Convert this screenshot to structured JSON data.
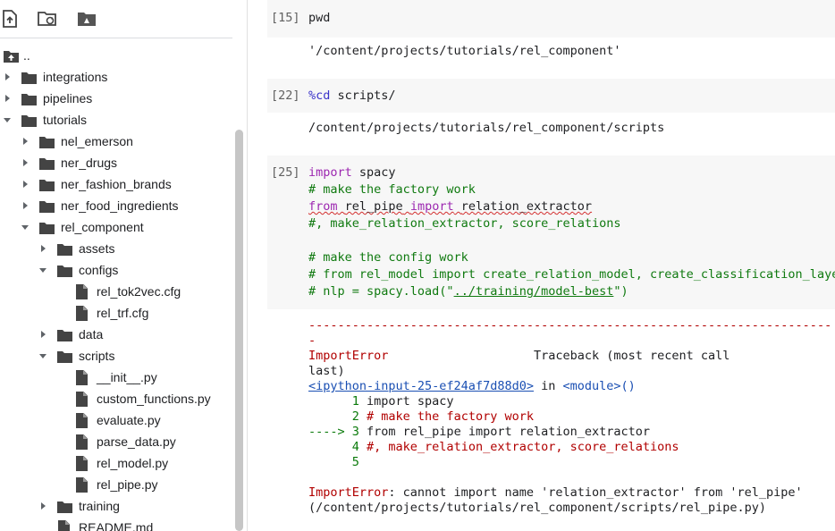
{
  "toolbar": {
    "icons": [
      "upload-file-icon",
      "refresh-folder-icon",
      "google-drive-icon"
    ]
  },
  "tree": [
    {
      "label": "..",
      "type": "up",
      "depth": 0,
      "arrow": "none"
    },
    {
      "label": "integrations",
      "type": "folder",
      "depth": 0,
      "arrow": "right"
    },
    {
      "label": "pipelines",
      "type": "folder",
      "depth": 0,
      "arrow": "right"
    },
    {
      "label": "tutorials",
      "type": "folder",
      "depth": 0,
      "arrow": "down"
    },
    {
      "label": "nel_emerson",
      "type": "folder",
      "depth": 1,
      "arrow": "right"
    },
    {
      "label": "ner_drugs",
      "type": "folder",
      "depth": 1,
      "arrow": "right"
    },
    {
      "label": "ner_fashion_brands",
      "type": "folder",
      "depth": 1,
      "arrow": "right"
    },
    {
      "label": "ner_food_ingredients",
      "type": "folder",
      "depth": 1,
      "arrow": "right"
    },
    {
      "label": "rel_component",
      "type": "folder",
      "depth": 1,
      "arrow": "down"
    },
    {
      "label": "assets",
      "type": "folder",
      "depth": 2,
      "arrow": "right"
    },
    {
      "label": "configs",
      "type": "folder",
      "depth": 2,
      "arrow": "down"
    },
    {
      "label": "rel_tok2vec.cfg",
      "type": "file",
      "depth": 3,
      "arrow": "none"
    },
    {
      "label": "rel_trf.cfg",
      "type": "file",
      "depth": 3,
      "arrow": "none"
    },
    {
      "label": "data",
      "type": "folder",
      "depth": 2,
      "arrow": "right"
    },
    {
      "label": "scripts",
      "type": "folder",
      "depth": 2,
      "arrow": "down"
    },
    {
      "label": "__init__.py",
      "type": "file",
      "depth": 3,
      "arrow": "none"
    },
    {
      "label": "custom_functions.py",
      "type": "file",
      "depth": 3,
      "arrow": "none"
    },
    {
      "label": "evaluate.py",
      "type": "file",
      "depth": 3,
      "arrow": "none"
    },
    {
      "label": "parse_data.py",
      "type": "file",
      "depth": 3,
      "arrow": "none"
    },
    {
      "label": "rel_model.py",
      "type": "file",
      "depth": 3,
      "arrow": "none"
    },
    {
      "label": "rel_pipe.py",
      "type": "file",
      "depth": 3,
      "arrow": "none"
    },
    {
      "label": "training",
      "type": "folder",
      "depth": 2,
      "arrow": "right"
    },
    {
      "label": "README.md",
      "type": "file",
      "depth": 2,
      "arrow": "none"
    }
  ],
  "cells": {
    "c15": {
      "count": "[15]",
      "code": "pwd",
      "output": "'/content/projects/tutorials/rel_component'"
    },
    "c22": {
      "count": "[22]",
      "magic": "%cd",
      "arg": " scripts/",
      "output": "/content/projects/tutorials/rel_component/scripts"
    },
    "c25": {
      "count": "[25]",
      "l1_kw": "import",
      "l1_rest": " spacy",
      "l2": "# make the factory work",
      "l3_kw1": "from",
      "l3_mod": "rel_pipe",
      "l3_kw2": "import",
      "l3_name": "relation_extractor",
      "l4": "#, make_relation_extractor, score_relations",
      "l6": "# make the config work",
      "l7": "# from rel_model import create_relation_model, create_classification_layer",
      "l8_pre": "# nlp = spacy.load(\"",
      "l8_link": "../training/model-best",
      "l8_post": "\")"
    }
  },
  "error": {
    "dashes": "------------------------------------------------------------------------",
    "dash2": "-",
    "err_name": "ImportError",
    "traceback_label": "Traceback (most recent call",
    "last": "last)",
    "input_link": "<ipython-input-25-ef24af7d88d0>",
    "in_word": " in ",
    "module": "<module>()",
    "tb1_num": "      1 ",
    "tb1_code": "import spacy",
    "tb2_num": "      2 ",
    "tb2_code": "# make the factory work",
    "tb3_num": "----> 3 ",
    "tb3_code": "from rel_pipe import relation_extractor",
    "tb4_num": "      4 ",
    "tb4_code": "#, make_relation_extractor, score_relations",
    "tb5_num": "      5",
    "msg_name": "ImportError",
    "msg": ": cannot import name 'relation_extractor' from 'rel_pipe'",
    "msg2": "(/content/projects/tutorials/rel_component/scripts/rel_pipe.py)"
  },
  "colors": {
    "keyword": "#9c27b0",
    "comment": "#107a10",
    "error": "#b10000",
    "link": "#1a4fb3"
  }
}
